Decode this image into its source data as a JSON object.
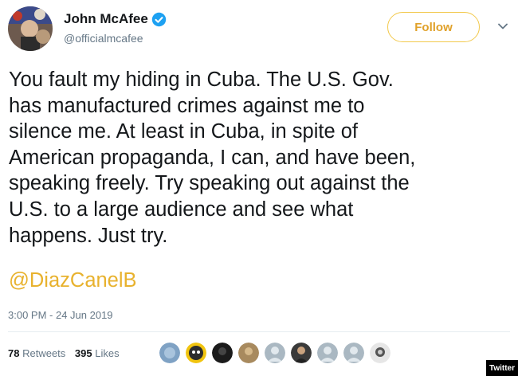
{
  "author": {
    "display_name": "John McAfee",
    "handle": "@officialmcafee",
    "verified": true,
    "avatar_icon": "profile-photo"
  },
  "follow_button": {
    "label": "Follow",
    "color": "#e0a12a"
  },
  "menu_icon": "chevron-down-icon",
  "tweet": {
    "lines": [
      "You fault my hiding in Cuba. The U.S. Gov.",
      "has manufactured crimes against me to",
      "silence me. At least in Cuba, in spite of",
      "American propaganda, I can, and have been,",
      "speaking freely. Try speaking out against the",
      "U.S. to a large audience and see what",
      "happens. Just try."
    ],
    "mention": "@DiazCanelB",
    "mention_color": "#e8b22e"
  },
  "timestamp": "3:00 PM - 24 Jun 2019",
  "stats": {
    "retweets_count": "78",
    "retweets_label": "Retweets",
    "likes_count": "395",
    "likes_label": "Likes"
  },
  "liker_avatar_count": 9,
  "watermark": "Twitter"
}
